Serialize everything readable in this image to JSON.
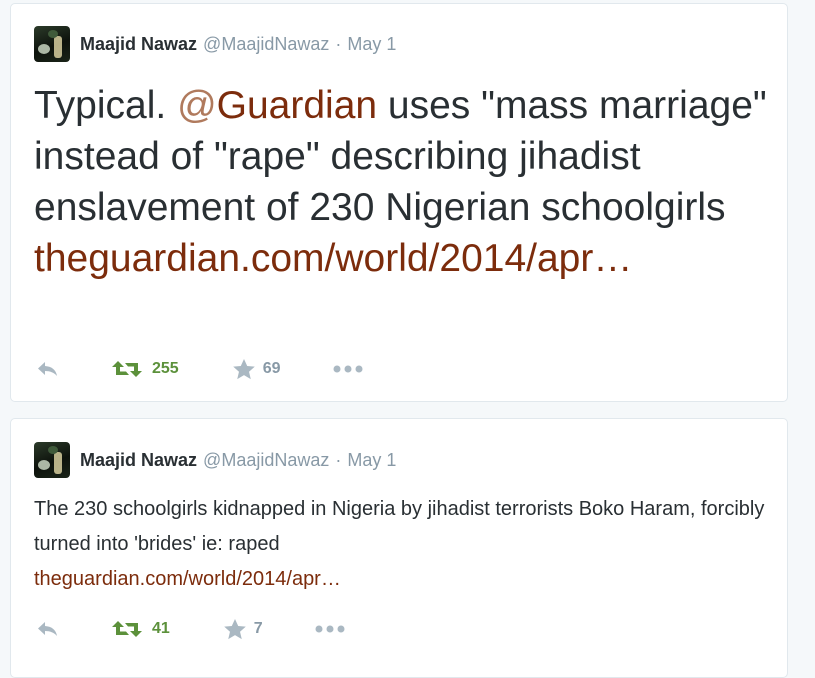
{
  "tweets": [
    {
      "author": {
        "fullname": "Maajid Nawaz",
        "screenname": "@MaajidNawaz"
      },
      "separator": "·",
      "time": "May 1",
      "text_before": "Typical. ",
      "mention_at": "@",
      "mention_name": "Guardian",
      "text_after": " uses \"mass marriage\" instead of \"rape\" describing jihadist enslavement of 230 Nigerian schoolgirls",
      "link": "theguardian.com/world/2014/apr…",
      "retweets": "255",
      "favorites": "69"
    },
    {
      "author": {
        "fullname": "Maajid Nawaz",
        "screenname": "@MaajidNawaz"
      },
      "separator": "·",
      "time": "May 1",
      "text": "The 230 schoolgirls kidnapped in Nigeria by jihadist terrorists Boko Haram, forcibly turned into 'brides' ie: raped",
      "link": "theguardian.com/world/2014/apr…",
      "retweets": "41",
      "favorites": "7"
    }
  ],
  "icons": {
    "reply": "reply-icon",
    "retweet": "retweet-icon",
    "favorite": "star-icon",
    "more": "more-dots-icon"
  },
  "colors": {
    "link": "#7c2c0c",
    "retweet_green": "#5c913b",
    "muted": "#8899a6",
    "text": "#292f33"
  }
}
